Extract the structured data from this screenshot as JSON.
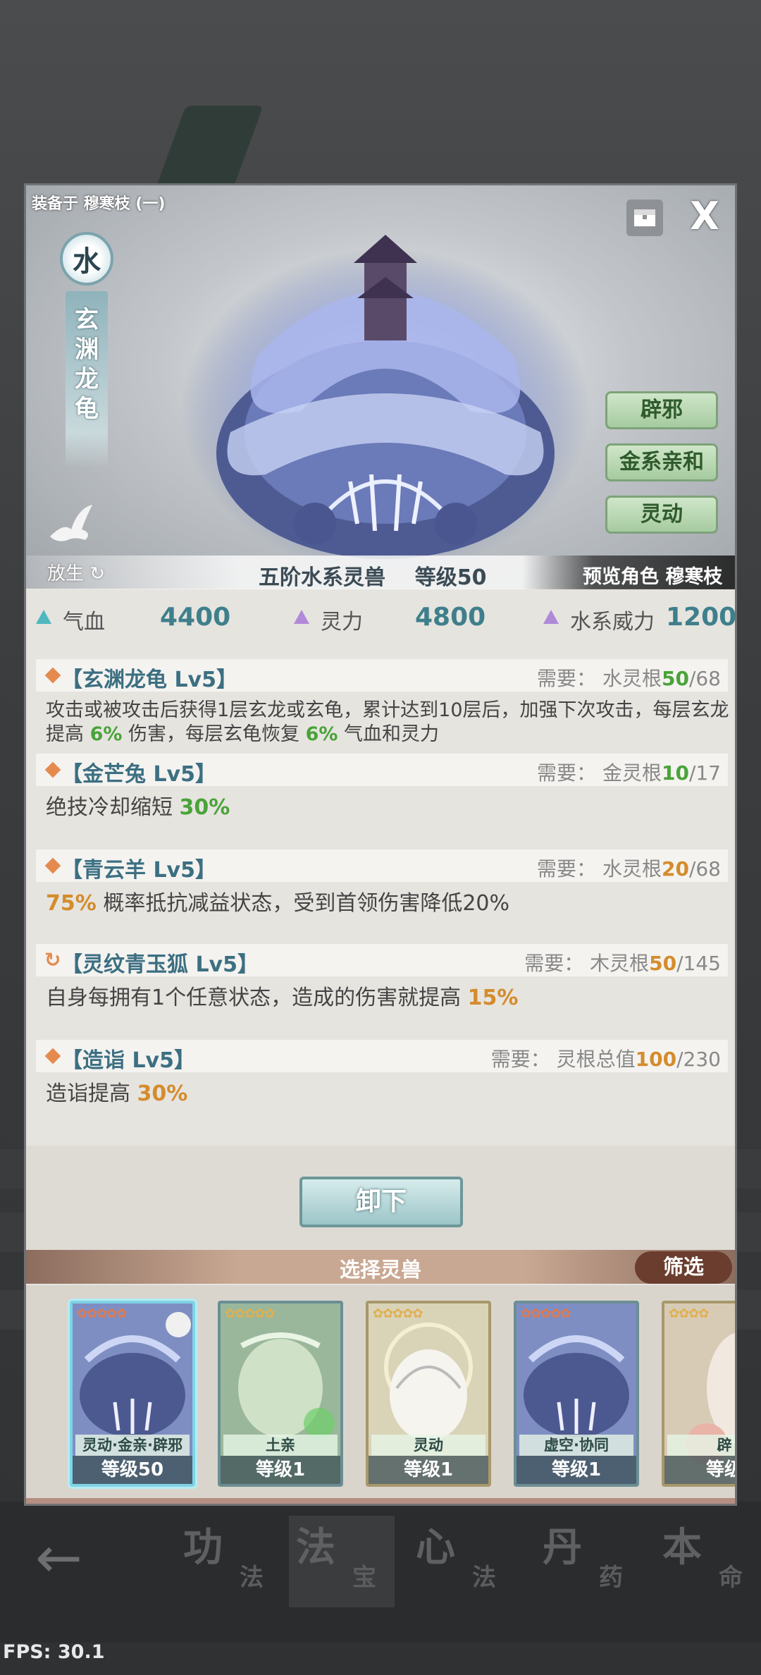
{
  "header": {
    "equipped_on": "装备于 穆寒枝 (一)",
    "close_label": "X"
  },
  "beast": {
    "element": "水",
    "name_chars": [
      "玄",
      "渊",
      "龙",
      "龟"
    ],
    "release_label": "放生",
    "rank_text": "五阶水系灵兽",
    "level_text": "等级50",
    "preview_text": "预览角色 穆寒枝",
    "traits": [
      "辟邪",
      "金系亲和",
      "灵动"
    ]
  },
  "stats": [
    {
      "icon": "teal-triangle-icon",
      "label": "气血",
      "value": "4400"
    },
    {
      "icon": "purple-triangle-icon",
      "label": "灵力",
      "value": "4800"
    },
    {
      "icon": "purple-triangle-icon",
      "label": "水系威力",
      "value": "1200"
    }
  ],
  "skills": [
    {
      "name": "【玄渊龙龟 Lv5】",
      "req_label": "需要：",
      "req_type": "水灵根",
      "req_have": "50",
      "req_total": "/68",
      "desc_parts": [
        "攻击或被攻击后获得1层玄龙或玄龟，累计达到10层后，加强下次攻击，每层玄龙提高 ",
        "6%",
        " 伤害，每层玄龟恢复 ",
        "6%",
        " 气血和灵力"
      ]
    },
    {
      "name": "【金芒兔 Lv5】",
      "req_label": "需要：",
      "req_type": "金灵根",
      "req_have": "10",
      "req_total": "/17",
      "desc_parts": [
        "绝技冷却缩短 ",
        "30%"
      ]
    },
    {
      "name": "【青云羊 Lv5】",
      "req_label": "需要：",
      "req_type": "水灵根",
      "req_have": "20",
      "req_total": "/68",
      "desc_parts": [
        "75%",
        " 概率抵抗减益状态，受到首领伤害降低20%"
      ]
    },
    {
      "name": "【灵纹青玉狐 Lv5】",
      "req_label": "需要：",
      "req_type": "木灵根",
      "req_have": "50",
      "req_total": "/145",
      "desc_parts": [
        "自身每拥有1个任意状态，造成的伤害就提高 ",
        "15%"
      ]
    },
    {
      "name": "【造诣 Lv5】",
      "req_label": "需要：",
      "req_type": "灵根总值",
      "req_have": "100",
      "req_total": "/230",
      "desc_parts": [
        "造诣提高 ",
        "30%"
      ]
    }
  ],
  "actions": {
    "unequip_label": "卸下"
  },
  "selector": {
    "title": "选择灵兽",
    "filter_label": "筛选",
    "cards": [
      {
        "tag": "灵动·金亲·辟邪",
        "level": "等级50",
        "stars": "✿✿✿✿✿"
      },
      {
        "tag": "土亲",
        "level": "等级1",
        "stars": "✿✿✿✿✿"
      },
      {
        "tag": "灵动",
        "level": "等级1",
        "stars": "✿✿✿✿✿"
      },
      {
        "tag": "虚空·协同",
        "level": "等级1",
        "stars": "✿✿✿✿✿"
      },
      {
        "tag": "辟",
        "level": "等级",
        "stars": "✿✿✿✿"
      }
    ]
  },
  "bottom_nav": {
    "back_label": "←",
    "tabs": [
      {
        "big": "功",
        "small": "法"
      },
      {
        "big": "法",
        "small": "宝"
      },
      {
        "big": "心",
        "small": "法"
      },
      {
        "big": "丹",
        "small": "药"
      },
      {
        "big": "本",
        "small": "命"
      }
    ]
  },
  "fps": "FPS: 30.1",
  "colors": {
    "green_value": "#4aa33a",
    "orange_value": "#d48c2c",
    "title_blue": "#3c6f82",
    "stat_value": "#3f7f8c"
  }
}
